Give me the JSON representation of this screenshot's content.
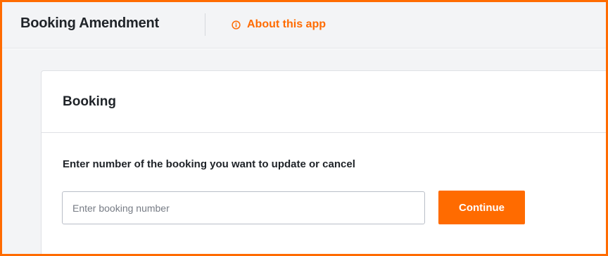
{
  "header": {
    "app_title": "Booking Amendment",
    "about_link": {
      "icon": "info-icon",
      "label": "About this app"
    }
  },
  "booking_card": {
    "title": "Booking",
    "instruction": "Enter number of the booking you want to update or cancel",
    "booking_number_input": {
      "value": "",
      "placeholder": "Enter booking number"
    },
    "continue_label": "Continue"
  },
  "colors": {
    "accent": "#ff6b00",
    "frame_border": "#ff6b00",
    "page_background": "#f3f4f6",
    "text_primary": "#1f2328",
    "card_background": "#ffffff"
  }
}
